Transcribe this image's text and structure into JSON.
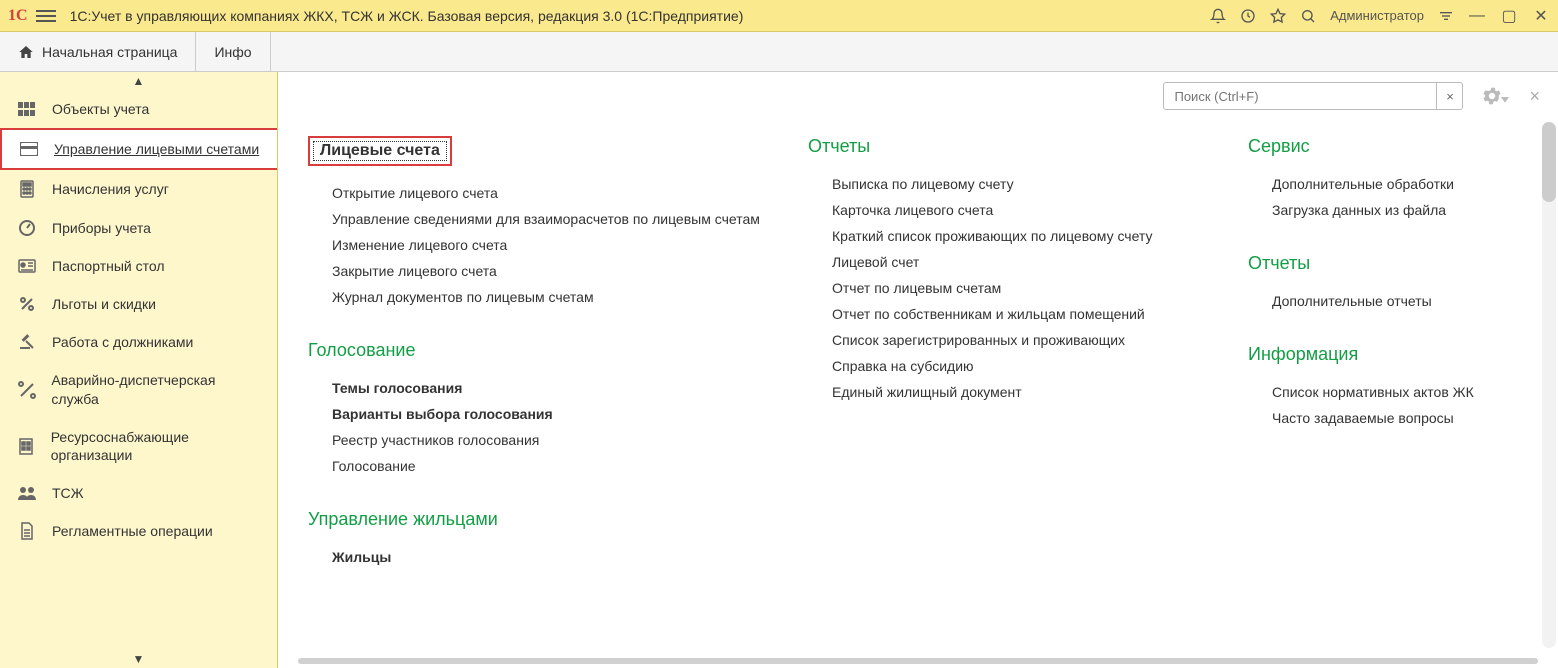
{
  "titlebar": {
    "title": "1С:Учет в управляющих компаниях ЖКХ, ТСЖ и ЖСК. Базовая версия, редакция 3.0  (1С:Предприятие)",
    "user": "Администратор"
  },
  "tabs": [
    {
      "label": "Начальная страница"
    },
    {
      "label": "Инфо"
    }
  ],
  "sidebar": {
    "items": [
      {
        "label": "Объекты учета",
        "icon": "grid"
      },
      {
        "label": "Управление лицевыми счетами",
        "icon": "card",
        "active": true
      },
      {
        "label": "Начисления услуг",
        "icon": "calculator"
      },
      {
        "label": "Приборы учета",
        "icon": "meter"
      },
      {
        "label": "Паспортный стол",
        "icon": "passport"
      },
      {
        "label": "Льготы и скидки",
        "icon": "percent"
      },
      {
        "label": "Работа с должниками",
        "icon": "gavel"
      },
      {
        "label": "Аварийно-диспетчерская служба",
        "icon": "tools"
      },
      {
        "label": "Ресурсоснабжающие организации",
        "icon": "building"
      },
      {
        "label": "ТСЖ",
        "icon": "people"
      },
      {
        "label": "Регламентные операции",
        "icon": "document"
      }
    ]
  },
  "content": {
    "search_placeholder": "Поиск (Ctrl+F)",
    "col1": {
      "section1": {
        "title": "Лицевые счета",
        "links": [
          "Открытие лицевого счета",
          "Управление сведениями для взаиморасчетов по лицевым счетам",
          "Изменение лицевого счета",
          "Закрытие лицевого счета",
          "Журнал документов по лицевым счетам"
        ]
      },
      "section2": {
        "title": "Голосование",
        "links": [
          {
            "text": "Темы голосования",
            "bold": true
          },
          {
            "text": "Варианты выбора голосования",
            "bold": true
          },
          {
            "text": "Реестр участников голосования",
            "bold": false
          },
          {
            "text": "Голосование",
            "bold": false
          }
        ]
      },
      "section3": {
        "title": "Управление жильцами",
        "links": [
          {
            "text": "Жильцы",
            "bold": true
          }
        ]
      }
    },
    "col2": {
      "section1": {
        "title": "Отчеты",
        "links": [
          "Выписка по лицевому счету",
          "Карточка лицевого счета",
          "Краткий список проживающих по лицевому счету",
          "Лицевой счет",
          "Отчет по лицевым счетам",
          "Отчет по собственникам и жильцам помещений",
          "Список зарегистрированных и проживающих",
          "Справка на субсидию",
          "Единый жилищный документ"
        ]
      }
    },
    "col3": {
      "section1": {
        "title": "Сервис",
        "links": [
          "Дополнительные обработки",
          "Загрузка данных из файла"
        ]
      },
      "section2": {
        "title": "Отчеты",
        "links": [
          "Дополнительные отчеты"
        ]
      },
      "section3": {
        "title": "Информация",
        "links": [
          "Список нормативных актов ЖК",
          "Часто задаваемые вопросы"
        ]
      }
    }
  }
}
